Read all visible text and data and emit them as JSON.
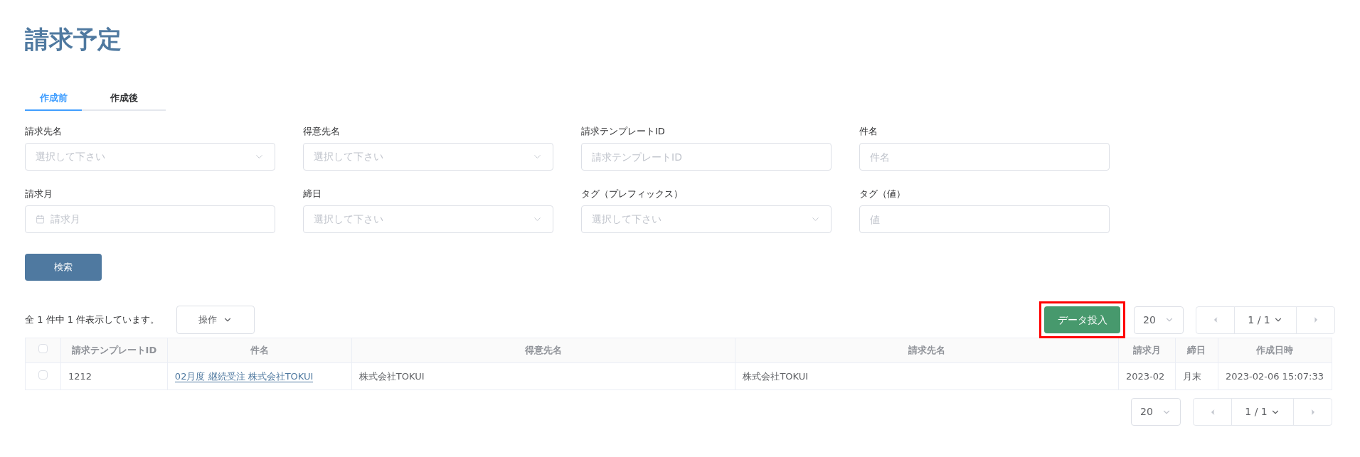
{
  "title": "請求予定",
  "tabs": [
    {
      "label": "作成前",
      "selected": true
    },
    {
      "label": "作成後",
      "selected": false
    }
  ],
  "filters": [
    {
      "label": "請求先名",
      "kind": "select",
      "placeholder": "選択して下さい"
    },
    {
      "label": "得意先名",
      "kind": "select",
      "placeholder": "選択して下さい"
    },
    {
      "label": "請求テンプレートID",
      "kind": "text",
      "placeholder": "請求テンプレートID"
    },
    {
      "label": "件名",
      "kind": "text",
      "placeholder": "件名"
    },
    {
      "label": "請求月",
      "kind": "date",
      "placeholder": "請求月"
    },
    {
      "label": "締日",
      "kind": "select",
      "placeholder": "選択して下さい"
    },
    {
      "label": "タグ（プレフィックス）",
      "kind": "select",
      "placeholder": "選択して下さい"
    },
    {
      "label": "タグ（値）",
      "kind": "text",
      "placeholder": "値"
    }
  ],
  "search_button": "検索",
  "result_count": "全 1 件中 1 件表示しています。",
  "actions_button": "操作",
  "import_button": {
    "label": "データ投入",
    "highlighted": true
  },
  "page_size": "20",
  "page": "1 / 1",
  "table": {
    "select_all_checked": false,
    "columns": [
      "請求テンプレートID",
      "件名",
      "得意先名",
      "請求先名",
      "請求月",
      "締日",
      "作成日時"
    ],
    "rows": [
      {
        "checked": false,
        "cells": [
          "1212",
          "02月度 継続受注 株式会社TOKUI",
          "株式会社TOKUI",
          "株式会社TOKUI",
          "2023-02",
          "月末",
          "2023-02-06 15:07:33"
        ]
      }
    ]
  },
  "bottom_page_size": "20",
  "bottom_page": "1 / 1"
}
